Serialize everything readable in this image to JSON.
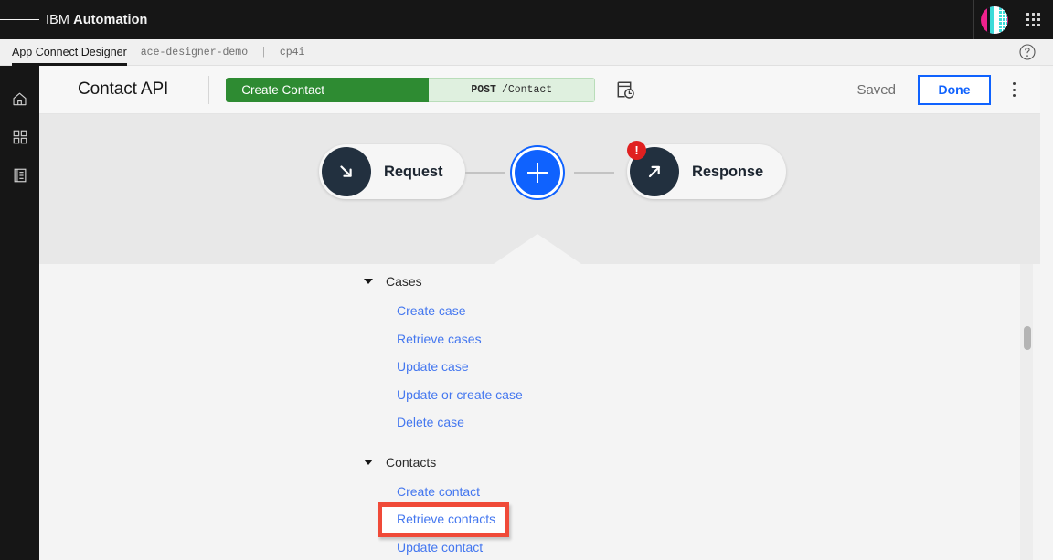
{
  "global_header": {
    "menu_icon": "hamburger-menu-icon",
    "brand_prefix": "IBM",
    "brand_name": "Automation",
    "avatar_icon": "user-avatar",
    "app_switcher_icon": "app-switcher-grid-icon"
  },
  "breadcrumb": {
    "active": "App Connect Designer",
    "instance": "ace-designer-demo",
    "separator": "|",
    "namespace": "cp4i",
    "help_icon": "help-circle-icon"
  },
  "rail": {
    "items": [
      {
        "name": "home",
        "icon": "home-icon"
      },
      {
        "name": "dashboard",
        "icon": "dashboard-grid-icon"
      },
      {
        "name": "catalog",
        "icon": "catalog-list-icon"
      }
    ]
  },
  "toolbar": {
    "flow_title": "Contact API",
    "operation_name": "Create Contact",
    "method": "POST",
    "path": "/Contact",
    "test_icon": "api-test-history-icon",
    "status": "Saved",
    "done_label": "Done",
    "overflow_icon": "kebab-menu-icon"
  },
  "flow": {
    "nodes": [
      {
        "label": "Request",
        "icon": "arrow-down-right-icon",
        "error": false
      },
      {
        "label": "Response",
        "icon": "arrow-up-right-icon",
        "error": true,
        "error_glyph": "!"
      }
    ],
    "add_node_icon": "plus-icon"
  },
  "picker": {
    "groups": [
      {
        "title": "Cases",
        "expanded": true,
        "actions": [
          "Create case",
          "Retrieve cases",
          "Update case",
          "Update or create case",
          "Delete case"
        ]
      },
      {
        "title": "Contacts",
        "expanded": true,
        "actions": [
          "Create contact",
          "Retrieve contacts",
          "Update contact"
        ]
      }
    ],
    "highlighted_action": "Retrieve contacts",
    "highlight_color": "#f04a38"
  },
  "colors": {
    "header_bg": "#161616",
    "accent_blue": "#0f62fe",
    "link_blue": "#4477ef",
    "method_green": "#2e8b32",
    "error_red": "#e02020",
    "canvas_bg": "#e8e8e8",
    "panel_bg": "#f4f4f4"
  }
}
